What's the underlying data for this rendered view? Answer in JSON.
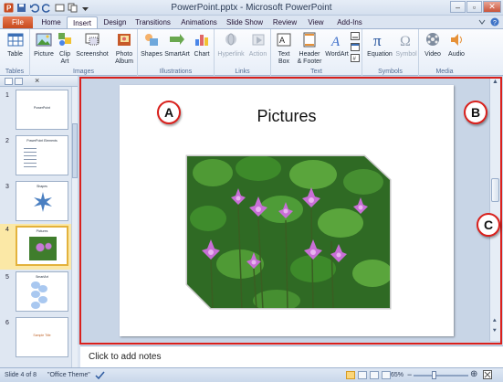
{
  "window": {
    "title": "PowerPoint.pptx - Microsoft PowerPoint"
  },
  "tabs": [
    {
      "label": "File"
    },
    {
      "label": "Home"
    },
    {
      "label": "Insert"
    },
    {
      "label": "Design"
    },
    {
      "label": "Transitions"
    },
    {
      "label": "Animations"
    },
    {
      "label": "Slide Show"
    },
    {
      "label": "Review"
    },
    {
      "label": "View"
    },
    {
      "label": "Add-Ins"
    }
  ],
  "ribbon": {
    "groups": [
      {
        "label": "Tables"
      },
      {
        "label": "Images"
      },
      {
        "label": "Illustrations"
      },
      {
        "label": "Links"
      },
      {
        "label": "Text"
      },
      {
        "label": "Symbols"
      },
      {
        "label": "Media"
      }
    ],
    "buttons": [
      {
        "label": "Table",
        "label2": ""
      },
      {
        "label": "Picture",
        "label2": ""
      },
      {
        "label": "Clip",
        "label2": "Art"
      },
      {
        "label": "Screenshot",
        "label2": ""
      },
      {
        "label": "Photo",
        "label2": "Album"
      },
      {
        "label": "Shapes",
        "label2": ""
      },
      {
        "label": "SmartArt",
        "label2": ""
      },
      {
        "label": "Chart",
        "label2": ""
      },
      {
        "label": "Hyperlink",
        "label2": ""
      },
      {
        "label": "Action",
        "label2": ""
      },
      {
        "label": "Text",
        "label2": "Box"
      },
      {
        "label": "Header",
        "label2": "& Footer"
      },
      {
        "label": "WordArt",
        "label2": ""
      },
      {
        "label": "Equation",
        "label2": ""
      },
      {
        "label": "Symbol",
        "label2": ""
      },
      {
        "label": "Video",
        "label2": ""
      },
      {
        "label": "Audio",
        "label2": ""
      }
    ]
  },
  "thumbnails": [
    {
      "number": "1",
      "text": "PowerPoint"
    },
    {
      "number": "2",
      "text": "PowerPoint Elements"
    },
    {
      "number": "3",
      "text": "Shapes"
    },
    {
      "number": "4",
      "text": "Pictures"
    },
    {
      "number": "5",
      "text": "SmartArt"
    },
    {
      "number": "6",
      "text": "Sample Title"
    }
  ],
  "slide": {
    "title": "Pictures"
  },
  "callouts": {
    "a": "A",
    "b": "B",
    "c": "C"
  },
  "notes": {
    "placeholder": "Click to add notes"
  },
  "status": {
    "slide": "Slide 4 of 8",
    "theme": "\"Office Theme\"",
    "zoom": "65%"
  }
}
